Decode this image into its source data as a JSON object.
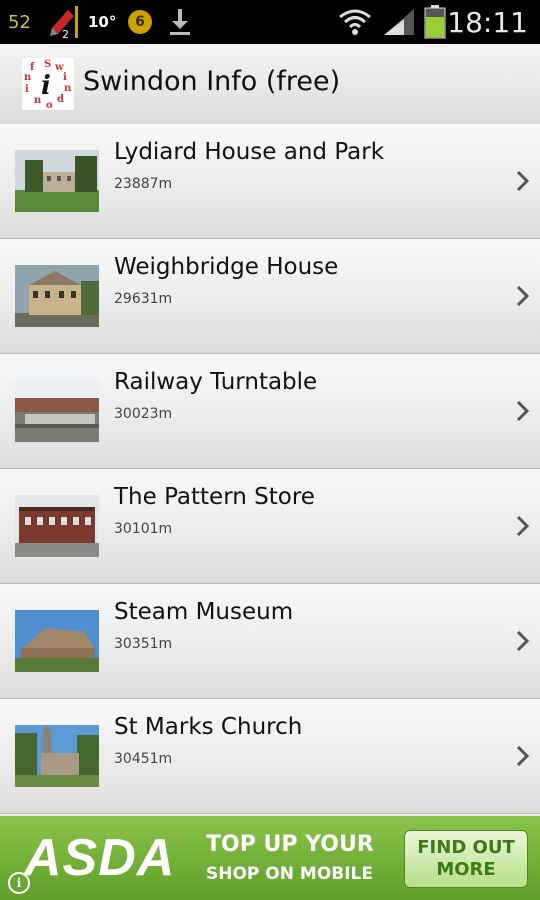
{
  "status_bar": {
    "notification_count": "52",
    "pen_badge": "2",
    "temperature": "10°",
    "coin_label": "6",
    "clock": "18:11",
    "icons": [
      "pen-icon",
      "coin-icon",
      "download-icon",
      "wifi-icon",
      "signal-icon",
      "battery-icon"
    ]
  },
  "app": {
    "title": "Swindon Info (free)"
  },
  "places": [
    {
      "name": "Lydiard House and Park",
      "distance": "23887m"
    },
    {
      "name": "Weighbridge House",
      "distance": "29631m"
    },
    {
      "name": "Railway Turntable",
      "distance": "30023m"
    },
    {
      "name": "The Pattern Store",
      "distance": "30101m"
    },
    {
      "name": "Steam Museum",
      "distance": "30351m"
    },
    {
      "name": "St Marks Church",
      "distance": "30451m"
    }
  ],
  "ad": {
    "brand": "ASDA",
    "line1": "TOP UP YOUR",
    "line2": "SHOP ON MOBILE",
    "button_line1": "FIND OUT",
    "button_line2": "MORE"
  },
  "colors": {
    "ad_green": "#7cb342",
    "battery_green": "#9ccc33",
    "logo_red": "#d32f2f"
  }
}
